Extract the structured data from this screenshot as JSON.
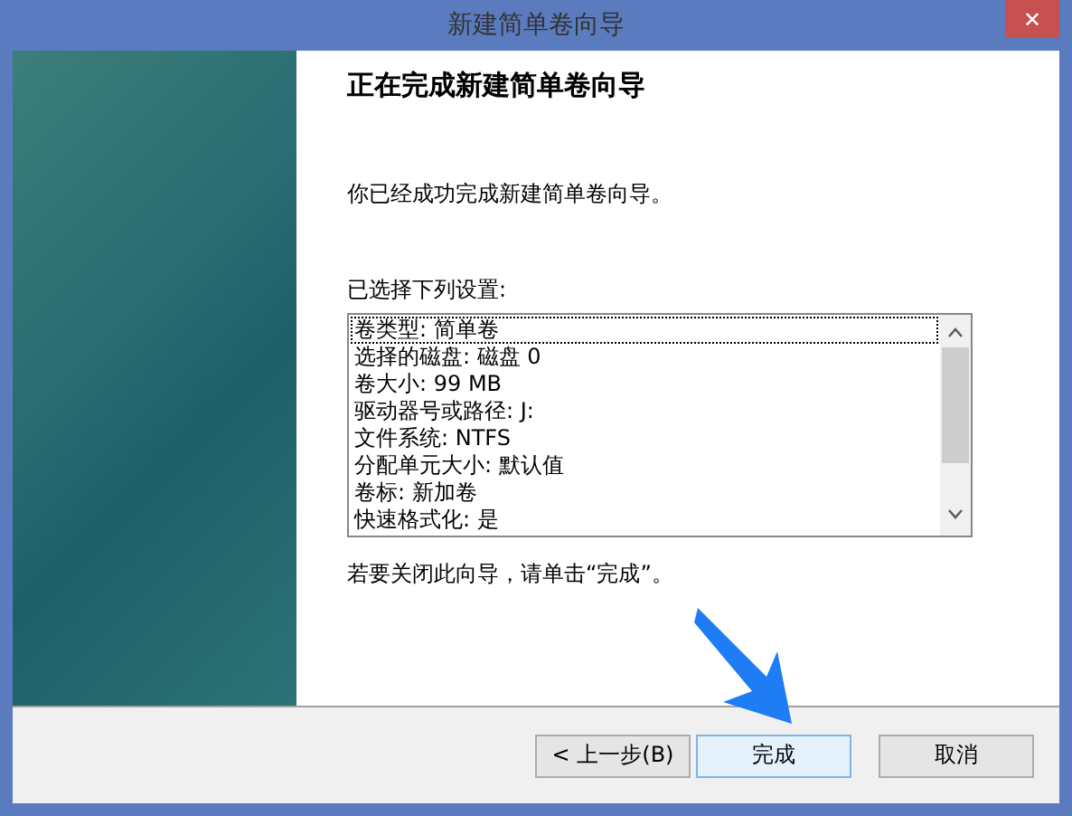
{
  "window": {
    "title": "新建简单卷向导",
    "close": "✕"
  },
  "heading": "正在完成新建简单卷向导",
  "message": "你已经成功完成新建简单卷向导。",
  "settings_label": "已选择下列设置:",
  "settings": [
    {
      "text": "卷类型: 简单卷",
      "selected": true
    },
    {
      "text": "选择的磁盘: 磁盘 0",
      "selected": false
    },
    {
      "text": "卷大小: 99 MB",
      "selected": false
    },
    {
      "text": "驱动器号或路径: J:",
      "selected": false
    },
    {
      "text": "文件系统: NTFS",
      "selected": false
    },
    {
      "text": "分配单元大小: 默认值",
      "selected": false
    },
    {
      "text": "卷标: 新加卷",
      "selected": false
    },
    {
      "text": "快速格式化: 是",
      "selected": false
    }
  ],
  "closing_hint": "若要关闭此向导，请单击“完成”。",
  "buttons": [
    {
      "label": "< 上一步(B)",
      "default": false
    },
    {
      "label": "完成",
      "default": true
    },
    {
      "label": "取消",
      "default": false
    }
  ]
}
